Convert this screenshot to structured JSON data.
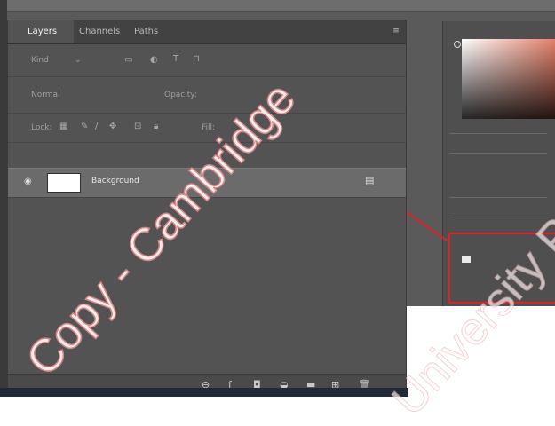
{
  "tabs": [
    {
      "label": "Layers",
      "active": true
    },
    {
      "label": "Channels",
      "active": false
    },
    {
      "label": "Paths",
      "active": false
    }
  ],
  "panel_menu_icon": "menu-icon",
  "filter": {
    "kind_value": "Kind",
    "icons": [
      "image-filter-icon",
      "adjustment-filter-icon",
      "type-filter-icon",
      "shape-filter-icon"
    ]
  },
  "blend": {
    "mode_value": "Normal",
    "opacity_label": "Opacity:"
  },
  "lock": {
    "label": "Lock:",
    "icons": [
      "lock-transparent-icon",
      "lock-pixels-icon",
      "brush-icon",
      "move-icon",
      "artboard-icon",
      "lock-all-icon"
    ],
    "fill_label": "Fill:"
  },
  "layers": [
    {
      "name": "Background",
      "visible": true,
      "locked": true,
      "thumb_color": "#ffffff"
    }
  ],
  "bottom_bar": {
    "icons": [
      "link-icon",
      "fx-icon",
      "mask-icon",
      "adjustment-icon",
      "folder-icon",
      "new-layer-icon",
      "trash-icon"
    ]
  },
  "watermark": {
    "main": "Copy - Cambridge",
    "faint": "University Pr"
  },
  "colors": {
    "callout": "#e41e26",
    "panel_bg": "#535353",
    "selected_layer": "#6b6b6b"
  }
}
